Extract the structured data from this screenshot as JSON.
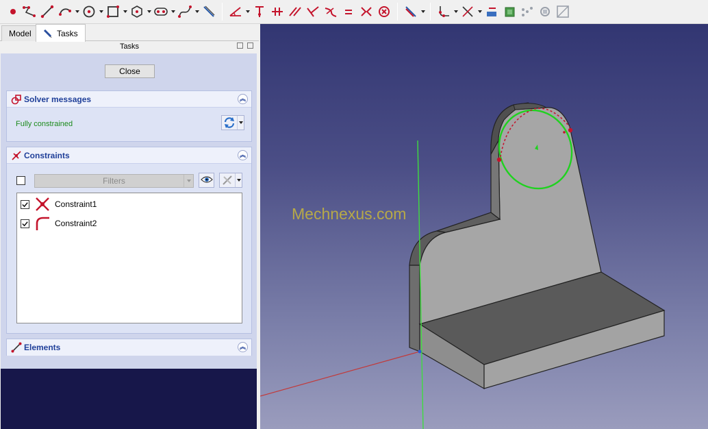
{
  "toolbar": {
    "groups": [
      [
        "point-icon",
        "polyline-icon",
        "line-icon",
        "arc-icon",
        "circle-icon",
        "rectangle-icon",
        "polygon-icon",
        "slot-icon",
        "bspline-icon",
        "construction-mode-icon"
      ],
      [
        "dimension-icon",
        "vertical-dist-icon",
        "horizontal-dist-icon",
        "parallel-icon",
        "perpendicular-icon",
        "tangent-icon",
        "equal-icon",
        "symmetric-icon",
        "block-icon",
        "reference-toggle-icon"
      ],
      [
        "fillet-icon",
        "trim-icon",
        "external-geometry-icon",
        "carbon-copy-icon",
        "array-icon",
        "clone-icon",
        "mirror-icon"
      ]
    ]
  },
  "tabs": {
    "model": "Model",
    "tasks": "Tasks"
  },
  "panel_title": "Tasks",
  "close_label": "Close",
  "solver": {
    "title": "Solver messages",
    "status": "Fully constrained",
    "status_color": "#1b8a1b"
  },
  "constraints": {
    "title": "Constraints",
    "filter_placeholder": "Filters",
    "items": [
      {
        "label": "Constraint1",
        "icon": "coincident-icon",
        "checked": true
      },
      {
        "label": "Constraint2",
        "icon": "tangent-arc-icon",
        "checked": true
      }
    ]
  },
  "elements": {
    "title": "Elements"
  },
  "viewport": {
    "watermark": "Mechnexus.com",
    "accent_colors": {
      "sketch_curve": "#1fd21f",
      "x_axis": "#c23a3a",
      "y_axis": "#3fdc3f",
      "model_face": "#a6a6a6"
    }
  }
}
